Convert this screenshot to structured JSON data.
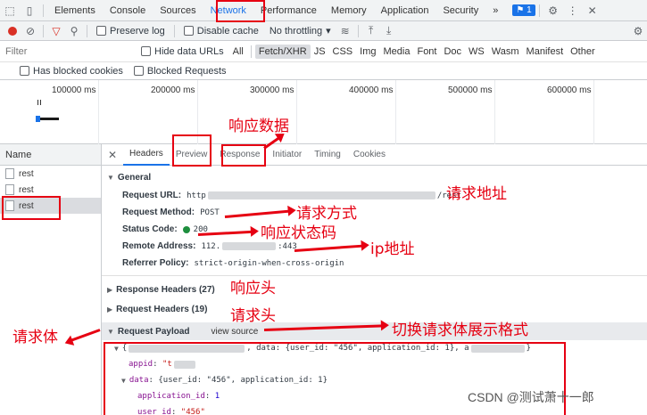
{
  "topbar": {
    "tabs": [
      "Elements",
      "Console",
      "Sources",
      "Network",
      "Performance",
      "Memory",
      "Application",
      "Security"
    ],
    "more": "»",
    "issues_count": "1"
  },
  "toolbar": {
    "preserve_log": "Preserve log",
    "disable_cache": "Disable cache",
    "throttling": "No throttling"
  },
  "filter": {
    "placeholder": "Filter",
    "hide_data_urls": "Hide data URLs",
    "types": [
      "All",
      "Fetch/XHR",
      "JS",
      "CSS",
      "Img",
      "Media",
      "Font",
      "Doc",
      "WS",
      "Wasm",
      "Manifest",
      "Other"
    ],
    "has_blocked_cookies": "Has blocked cookies",
    "blocked_requests": "Blocked Requests"
  },
  "timeline": {
    "ticks": [
      "100000 ms",
      "200000 ms",
      "300000 ms",
      "400000 ms",
      "500000 ms",
      "600000 ms"
    ]
  },
  "name_panel": {
    "header": "Name",
    "rows": [
      "rest",
      "rest",
      "rest"
    ]
  },
  "detail": {
    "tabs": [
      "Headers",
      "Preview",
      "Response",
      "Initiator",
      "Timing",
      "Cookies"
    ],
    "general_title": "General",
    "request_url_key": "Request URL:",
    "request_url_prefix": "http",
    "request_url_suffix": "/rest",
    "request_method_key": "Request Method:",
    "request_method": "POST",
    "status_code_key": "Status Code:",
    "status_code": "200",
    "remote_address_key": "Remote Address:",
    "remote_address_prefix": "112.",
    "remote_address_suffix": ":443",
    "referrer_key": "Referrer Policy:",
    "referrer": "strict-origin-when-cross-origin",
    "response_headers": "Response Headers (27)",
    "request_headers": "Request Headers (19)",
    "payload_title": "Request Payload",
    "view_source": "view source",
    "payload_line1": ", data: {user_id: \"456\", application_id: 1}, a",
    "payload_appid_key": "appid",
    "payload_appid_val": "\"t",
    "payload_data_key": "data",
    "payload_data_summary": "{user_id: \"456\", application_id: 1}",
    "payload_app_id_key": "application_id",
    "payload_app_id_val": "1",
    "payload_user_id_key": "user_id",
    "payload_user_id_val": "\"456\""
  },
  "annotations": {
    "response_data": "响应数据",
    "request_address": "请求地址",
    "request_method": "请求方式",
    "response_status": "响应状态码",
    "ip_address": "ip地址",
    "response_headers": "响应头",
    "request_headers": "请求头",
    "request_body": "请求体",
    "switch_format": "切换请求体展示格式"
  },
  "watermark": "CSDN @测试萧十一郎",
  "colors": {
    "accent": "#1a73e8",
    "annotation": "#e60012",
    "status_ok": "#1e8e3e"
  }
}
